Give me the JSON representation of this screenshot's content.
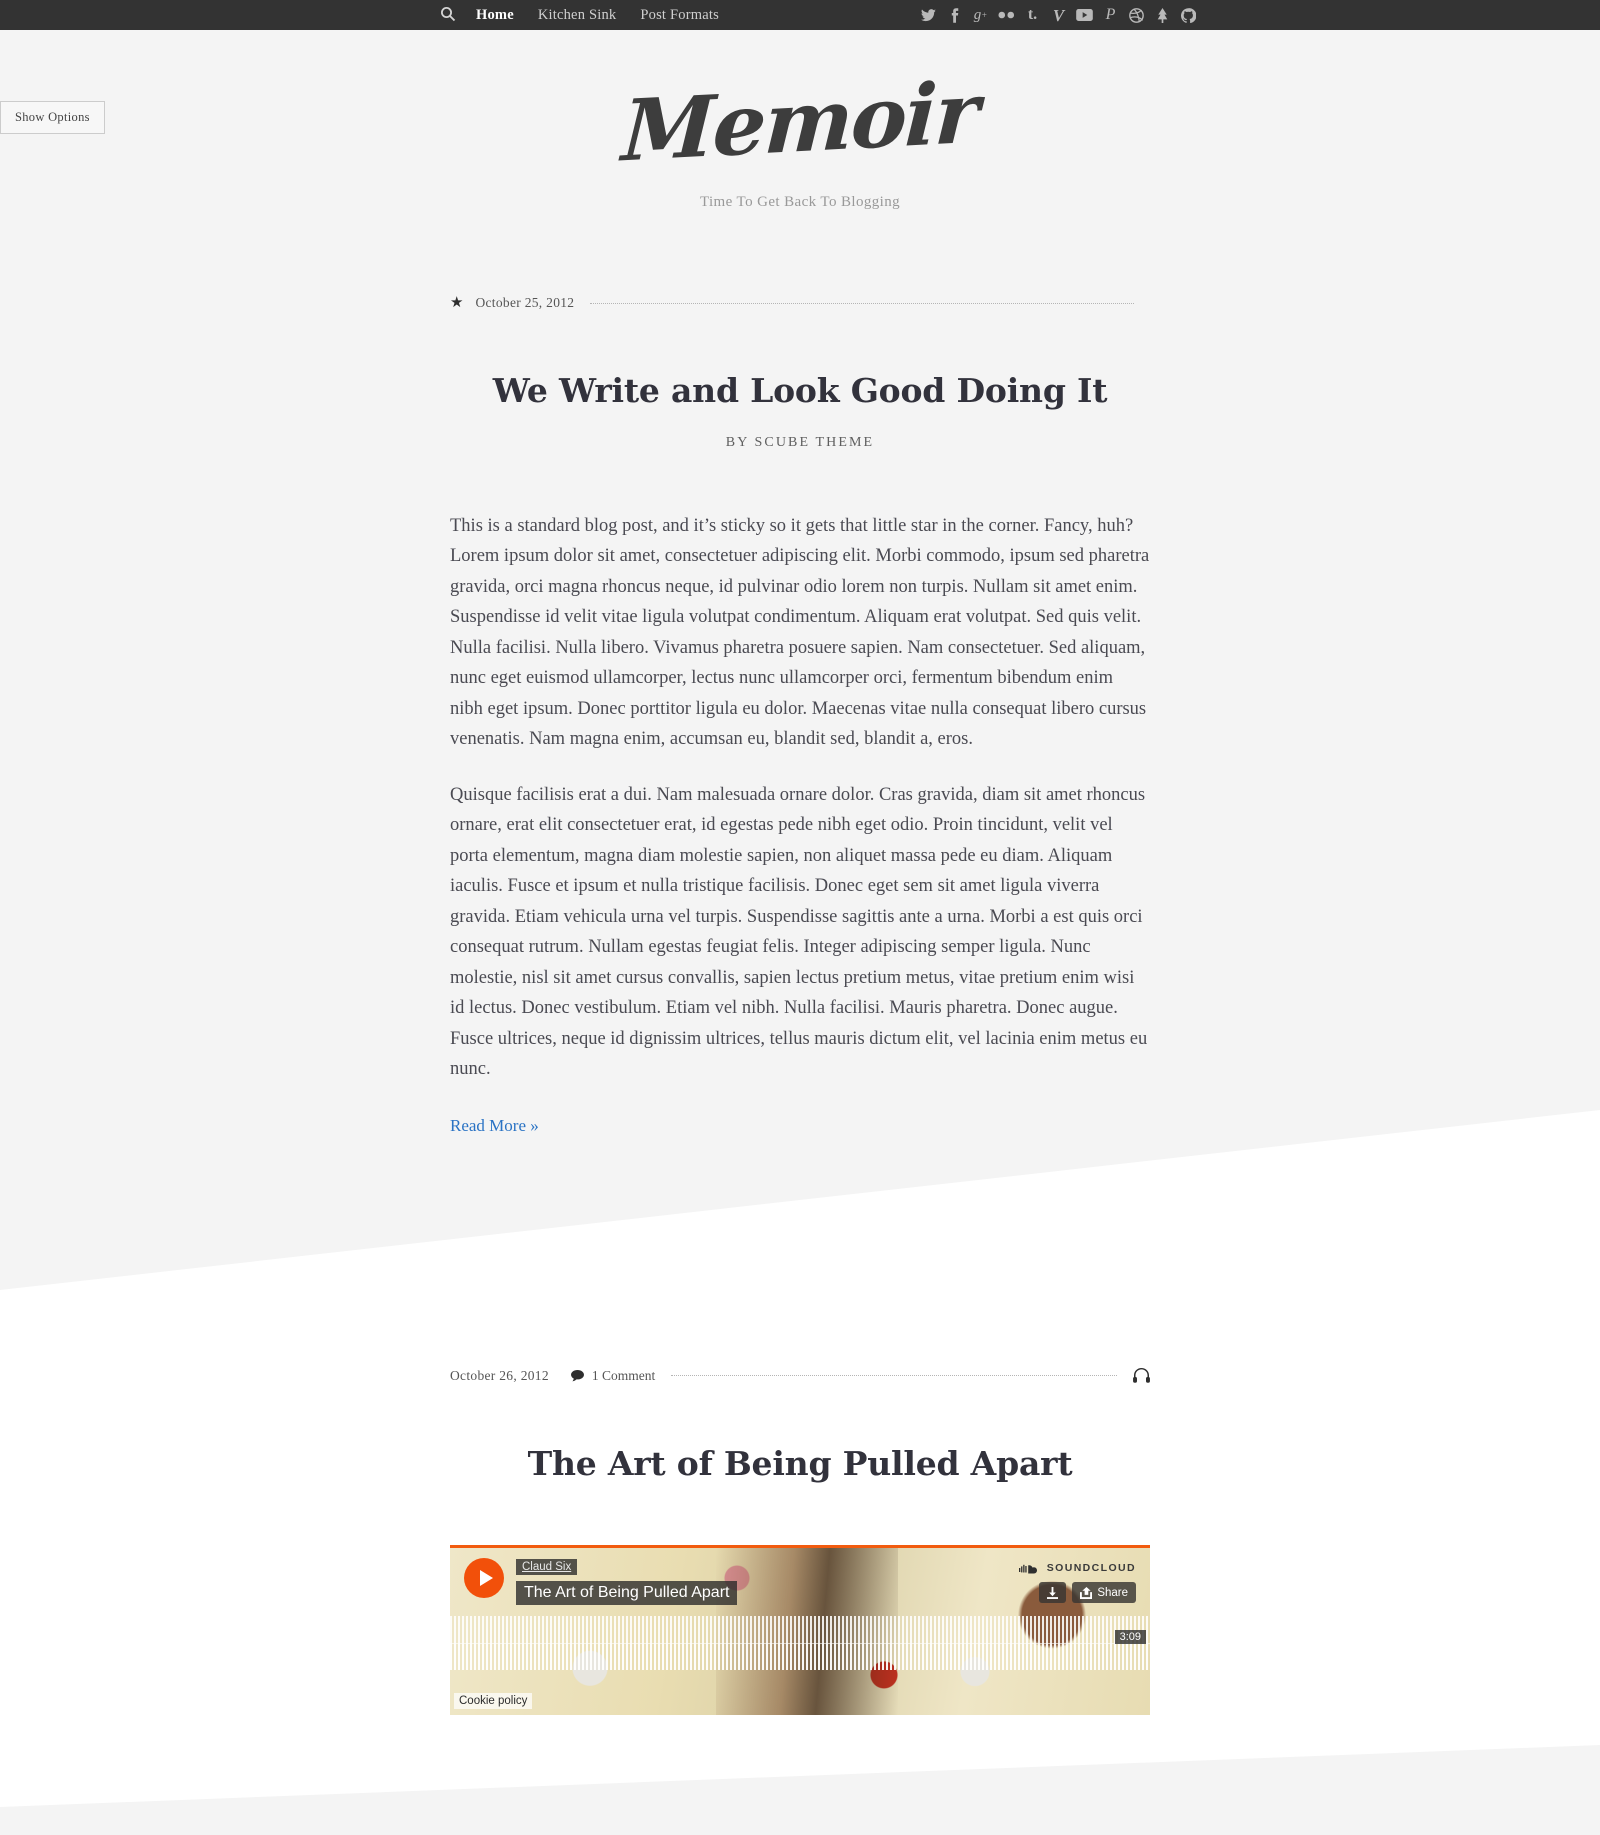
{
  "nav": {
    "search_icon": "search-icon",
    "items": [
      {
        "label": "Home",
        "active": true
      },
      {
        "label": "Kitchen Sink",
        "active": false
      },
      {
        "label": "Post Formats",
        "active": false
      }
    ],
    "social": [
      {
        "name": "twitter-icon",
        "glyph": "🐦"
      },
      {
        "name": "facebook-icon",
        "glyph": "f"
      },
      {
        "name": "googleplus-icon",
        "glyph": "g+"
      },
      {
        "name": "flickr-icon",
        "glyph": "••"
      },
      {
        "name": "tumblr-icon",
        "glyph": "t."
      },
      {
        "name": "vimeo-icon",
        "glyph": "V"
      },
      {
        "name": "youtube-icon",
        "glyph": "▶"
      },
      {
        "name": "pinterest-icon",
        "glyph": "P"
      },
      {
        "name": "dribbble-icon",
        "glyph": "◎"
      },
      {
        "name": "forrst-icon",
        "glyph": "A"
      },
      {
        "name": "github-icon",
        "glyph": "⑂"
      }
    ]
  },
  "options_panel": {
    "toggle_label": "Show Options"
  },
  "masthead": {
    "logo_text": "Memoir",
    "tagline": "Time To Get Back To Blogging"
  },
  "posts": [
    {
      "sticky": true,
      "star_glyph": "★",
      "date": "October 25, 2012",
      "title": "We Write and Look Good Doing It",
      "byline": "BY SCUBE THEME",
      "paragraphs": [
        "This is a standard blog post, and it’s sticky so it gets that little star in the corner. Fancy, huh? Lorem ipsum dolor sit amet, consectetuer adipiscing elit. Morbi commodo, ipsum sed pharetra gravida, orci magna rhoncus neque, id pulvinar odio lorem non turpis. Nullam sit amet enim. Suspendisse id velit vitae ligula volutpat condimentum. Aliquam erat volutpat. Sed quis velit. Nulla facilisi. Nulla libero. Vivamus pharetra posuere sapien. Nam consectetuer. Sed aliquam, nunc eget euismod ullamcorper, lectus nunc ullamcorper orci, fermentum bibendum enim nibh eget ipsum. Donec porttitor ligula eu dolor. Maecenas vitae nulla consequat libero cursus venenatis. Nam magna enim, accumsan eu, blandit sed, blandit a, eros.",
        "Quisque facilisis erat a dui. Nam malesuada ornare dolor. Cras gravida, diam sit amet rhoncus ornare, erat elit consectetuer erat, id egestas pede nibh eget odio. Proin tincidunt, velit vel porta elementum, magna diam molestie sapien, non aliquet massa pede eu diam. Aliquam iaculis. Fusce et ipsum et nulla tristique facilisis. Donec eget sem sit amet ligula viverra gravida. Etiam vehicula urna vel turpis. Suspendisse sagittis ante a urna. Morbi a est quis orci consequat rutrum. Nullam egestas feugiat felis. Integer adipiscing semper ligula. Nunc molestie, nisl sit amet cursus convallis, sapien lectus pretium metus, vitae pretium enim wisi id lectus. Donec vestibulum. Etiam vel nibh. Nulla facilisi. Mauris pharetra. Donec augue. Fusce ultrices, neque id dignissim ultrices, tellus mauris dictum elit, vel lacinia enim metus eu nunc."
      ],
      "read_more": "Read More »"
    },
    {
      "sticky": false,
      "date": "October 26, 2012",
      "comment_count": "1 Comment",
      "format_icon": "headphones-icon",
      "title": "The Art of Being Pulled Apart"
    }
  ],
  "soundcloud": {
    "artist": "Claud Six",
    "track": "The Art of Being Pulled Apart",
    "brand": "SOUNDCLOUD",
    "share_label": "Share",
    "download_icon": "download-icon",
    "duration": "3:09",
    "cookie_policy": "Cookie policy",
    "accent_color": "#f2500a"
  },
  "colors": {
    "topbar_bg": "#333333",
    "page_bg": "#f4f4f4",
    "link_blue": "#2a73c4",
    "body_text": "#4a4a52"
  }
}
